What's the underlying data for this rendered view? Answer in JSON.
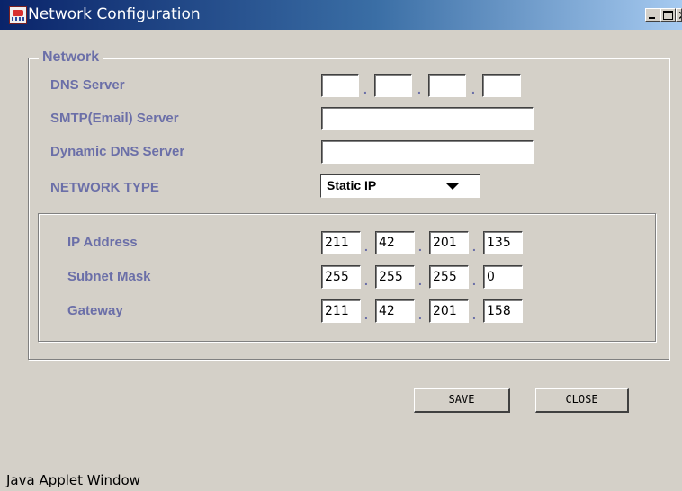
{
  "window": {
    "title": "Network Configuration"
  },
  "network": {
    "legend": "Network",
    "dns_server": {
      "label": "DNS Server",
      "octets": [
        "",
        "",
        "",
        ""
      ]
    },
    "smtp_server": {
      "label": "SMTP(Email) Server",
      "value": ""
    },
    "dynamic_dns": {
      "label": "Dynamic DNS Server",
      "value": ""
    },
    "network_type": {
      "label": "NETWORK TYPE",
      "selected": "Static IP"
    },
    "static": {
      "ip_address": {
        "label": "IP Address",
        "octets": [
          "211",
          "42",
          "201",
          "135"
        ]
      },
      "subnet_mask": {
        "label": "Subnet Mask",
        "octets": [
          "255",
          "255",
          "255",
          "0"
        ]
      },
      "gateway": {
        "label": "Gateway",
        "octets": [
          "211",
          "42",
          "201",
          "158"
        ]
      }
    },
    "separator": "."
  },
  "buttons": {
    "save": "SAVE",
    "close": "CLOSE"
  },
  "status": {
    "text": "Java Applet Window"
  },
  "colors": {
    "label": "#6b6fa8",
    "title_bar": "#0a246a",
    "face": "#d4d0c8"
  }
}
